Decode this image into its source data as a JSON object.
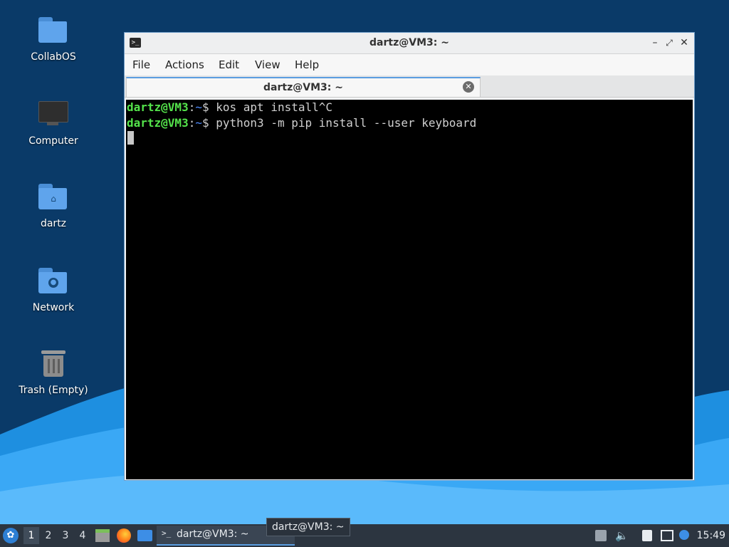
{
  "desktop": {
    "icons": [
      {
        "label": "CollabOS"
      },
      {
        "label": "Computer"
      },
      {
        "label": "dartz"
      },
      {
        "label": "Network"
      },
      {
        "label": "Trash (Empty)"
      }
    ]
  },
  "window": {
    "title": "dartz@VM3: ~",
    "menu": [
      "File",
      "Actions",
      "Edit",
      "View",
      "Help"
    ],
    "tab_label": "dartz@VM3: ~",
    "terminal": {
      "lines": [
        {
          "user": "dartz@VM3",
          "sep": ":",
          "path": "~",
          "prompt": "$ ",
          "command": "kos apt install^C"
        },
        {
          "user": "dartz@VM3",
          "sep": ":",
          "path": "~",
          "prompt": "$ ",
          "command": "python3 -m pip install --user keyboard"
        }
      ]
    }
  },
  "taskbar": {
    "workspaces": [
      "1",
      "2",
      "3",
      "4"
    ],
    "active_workspace": "1",
    "task_label": "dartz@VM3: ~",
    "tooltip": "dartz@VM3: ~",
    "clock": "15:49"
  },
  "colors": {
    "accent": "#5b9de0",
    "prompt_user": "#54e34b",
    "prompt_path": "#4f8cff",
    "desktop_bg": "#08345f"
  },
  "icons": {
    "start": "lxqt-start-icon",
    "files": "file-manager-icon",
    "browser": "firefox-icon",
    "desktop": "show-desktop-icon",
    "terminal": "terminal-icon",
    "tray": [
      "updates-icon",
      "volume-icon",
      "clipboard-icon",
      "network-icon",
      "notification-icon"
    ]
  }
}
